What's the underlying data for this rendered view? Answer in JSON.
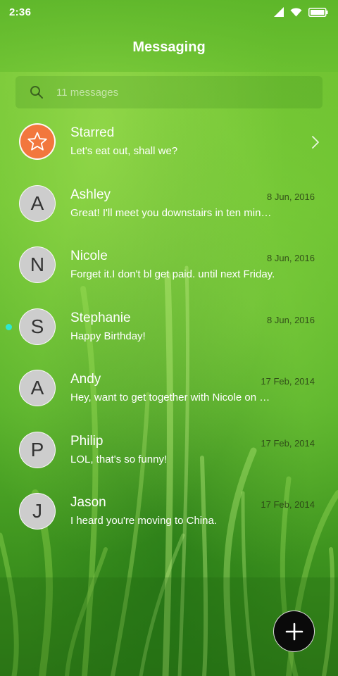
{
  "status_bar": {
    "time": "2:36",
    "icons": [
      "cellular-signal-icon",
      "wifi-icon",
      "battery-icon"
    ]
  },
  "header": {
    "title": "Messaging"
  },
  "search": {
    "placeholder": "11 messages"
  },
  "conversations": [
    {
      "name": "Starred",
      "preview": "Let's eat out, shall we?",
      "date": "",
      "avatar": "star-icon",
      "avatar_color": "#f2773d"
    },
    {
      "name": "Ashley",
      "preview": "Great! I'll meet you downstairs in ten minutes.",
      "date": "8 Jun, 2016",
      "avatar": "A"
    },
    {
      "name": "Nicole",
      "preview": "Forget it.I don't bl get paid. until next Friday.",
      "date": "8 Jun, 2016",
      "avatar": "N"
    },
    {
      "name": "Stephanie",
      "preview": "Happy Birthday!",
      "date": "8 Jun, 2016",
      "avatar": "S",
      "unread": true
    },
    {
      "name": "Andy",
      "preview": "Hey, want to get together with Nicole on Sunday?",
      "date": "17 Feb, 2014",
      "avatar": "A"
    },
    {
      "name": "Philip",
      "preview": "LOL, that's so funny!",
      "date": "17 Feb, 2014",
      "avatar": "P"
    },
    {
      "name": "Jason",
      "preview": "I heard you're moving to China.",
      "date": "17 Feb, 2014",
      "avatar": "J"
    }
  ],
  "fab": {
    "icon": "plus-icon"
  },
  "colors": {
    "starred_avatar": "#f2773d",
    "avatar_default": "#cdcdcd",
    "unread_dot": "#2ee8d2",
    "fab_background": "#0a0a0a"
  }
}
